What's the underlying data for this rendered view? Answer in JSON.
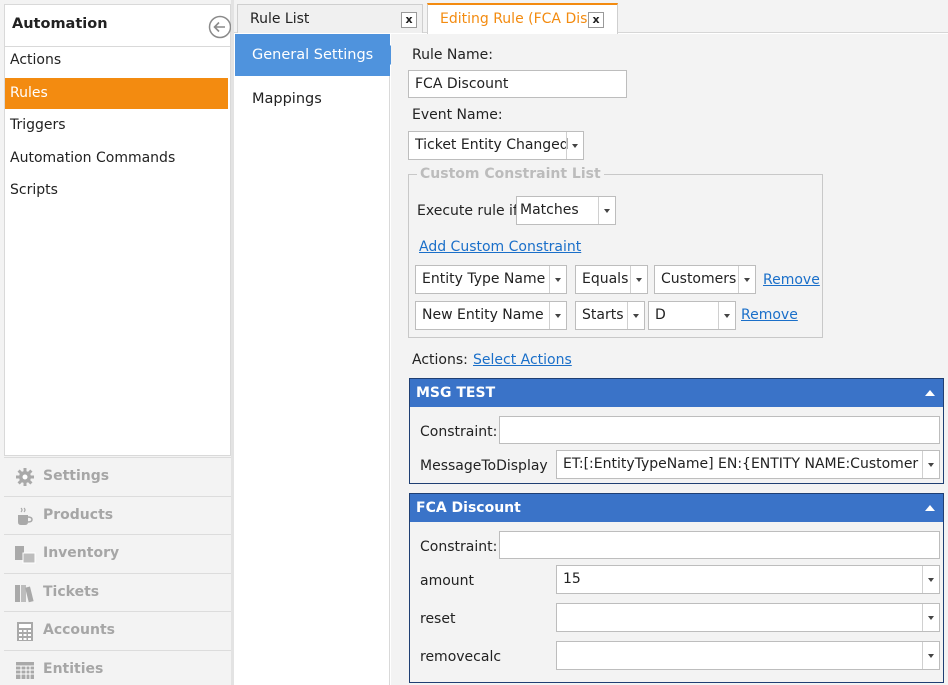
{
  "sidebar": {
    "title": "Automation",
    "back_icon": "circle-arrow-left-icon",
    "items": [
      {
        "label": "Actions"
      },
      {
        "label": "Rules"
      },
      {
        "label": "Triggers"
      },
      {
        "label": "Automation Commands"
      },
      {
        "label": "Scripts"
      }
    ],
    "active_item": "Rules",
    "categories": [
      {
        "label": "Settings",
        "icon": "gear-icon"
      },
      {
        "label": "Products",
        "icon": "coffee-cup-icon"
      },
      {
        "label": "Inventory",
        "icon": "boxes-icon"
      },
      {
        "label": "Tickets",
        "icon": "books-icon"
      },
      {
        "label": "Accounts",
        "icon": "calculator-icon"
      },
      {
        "label": "Entities",
        "icon": "table-icon"
      }
    ]
  },
  "tabs": [
    {
      "label": "Rule List",
      "close": "x"
    },
    {
      "label": "Editing Rule (FCA Disc",
      "close": "x"
    }
  ],
  "settings_nav": [
    {
      "label": "General Settings"
    },
    {
      "label": "Mappings"
    }
  ],
  "form": {
    "rule_name_label": "Rule Name:",
    "rule_name_value": "FCA Discount",
    "event_name_label": "Event Name:",
    "event_name_value": "Ticket Entity Changed",
    "constraints": {
      "title": "Custom Constraint List",
      "execute_label": "Execute rule if",
      "execute_value": "Matches",
      "add_link": "Add Custom Constraint",
      "rows": [
        {
          "field": "Entity Type Name",
          "op": "Equals",
          "value": "Customers",
          "remove": "Remove"
        },
        {
          "field": "New Entity Name",
          "op": "Starts",
          "value": "D",
          "remove": "Remove"
        }
      ]
    },
    "actions_label": "Actions:",
    "select_actions": "Select Actions",
    "actions": [
      {
        "title": "MSG TEST",
        "constraint_label": "Constraint:",
        "constraint_value": "",
        "params": [
          {
            "label": "MessageToDisplay",
            "value": "ET:[:EntityTypeName] EN:{ENTITY NAME:Customers}"
          }
        ]
      },
      {
        "title": "FCA Discount",
        "constraint_label": "Constraint:",
        "constraint_value": "",
        "params": [
          {
            "label": "amount",
            "value": "15"
          },
          {
            "label": "reset",
            "value": ""
          },
          {
            "label": "removecalc",
            "value": ""
          }
        ]
      }
    ]
  },
  "colors": {
    "accent_orange": "#f38b10",
    "nav_blue": "#4f93dd",
    "action_header": "#3a73c8",
    "link": "#1a6fc9"
  }
}
